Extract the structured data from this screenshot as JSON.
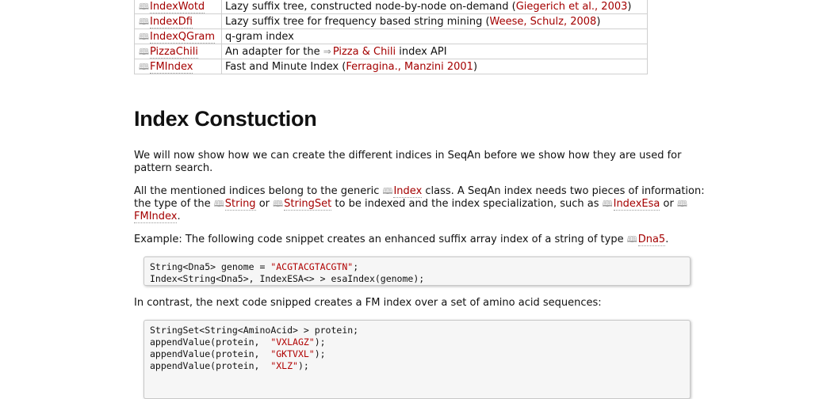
{
  "table_rows": [
    {
      "name": "IndexWotd",
      "desc_before": "Lazy suffix tree, constructed node-by-node on-demand (",
      "link": "Giegerich et al., 2003",
      "desc_after": ")"
    },
    {
      "name": "IndexDfi",
      "desc_before": "Lazy suffix tree for frequency based string mining (",
      "link": "Weese, Schulz, 2008",
      "desc_after": ")"
    },
    {
      "name": "IndexQGram",
      "desc_before": "q-gram index",
      "link": "",
      "desc_after": ""
    },
    {
      "name": "PizzaChili",
      "desc_before": "An adapter for the ",
      "link": "Pizza & Chili",
      "desc_after": " index API"
    },
    {
      "name": "FMIndex",
      "desc_before": "Fast and Minute Index (",
      "link": "Ferragina., Manzini 2001",
      "desc_after": ")"
    }
  ],
  "heading": "Index Constuction",
  "para1": "We will now show how we can create the different indices in SeqAn before we show how they are used for pattern search.",
  "para2": {
    "t1": "All the mentioned indices belong to the generic ",
    "l1": "Index",
    "t2": " class. A SeqAn index needs two pieces of information: the type of the ",
    "l2": "String",
    "t3": " or ",
    "l3": "StringSet",
    "t4": " to be indexed and the index specialization, such as ",
    "l4": "IndexEsa",
    "t5": " or ",
    "l5": "FMIndex",
    "t6": "."
  },
  "para3": {
    "t1": "Example: The following code snippet creates an enhanced suffix array index of a string of type ",
    "l1": "Dna5",
    "t2": "."
  },
  "code1": {
    "line1_a": "String<Dna5> genome = ",
    "line1_str": "\"ACGTACGTACGTN\"",
    "line1_b": ";",
    "line2": "Index<String<Dna5>, IndexESA<> > esaIndex(genome);"
  },
  "para4": "In contrast, the next code snipped creates a FM index over a set of amino acid sequences:",
  "code2": {
    "line1": "StringSet<String<AminoAcid> > protein;",
    "line2_a": "appendValue(protein,  ",
    "line2_str": "\"VXLAGZ\"",
    "line2_b": ");",
    "line3_a": "appendValue(protein,  ",
    "line3_str": "\"GKTVXL\"",
    "line3_b": ");",
    "line4_a": "appendValue(protein,  ",
    "line4_str": "\"XLZ\"",
    "line4_b": ");"
  }
}
